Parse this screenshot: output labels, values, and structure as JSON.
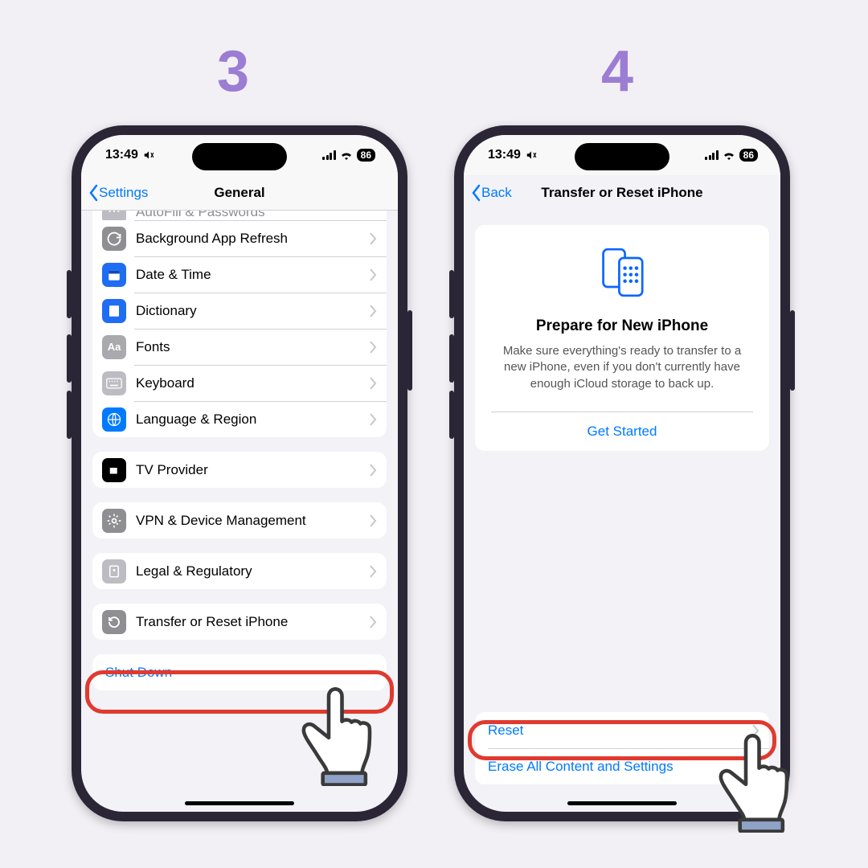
{
  "steps": {
    "three": "3",
    "four": "4"
  },
  "status": {
    "time": "13:49",
    "battery": "86"
  },
  "phone3": {
    "nav_back": "Settings",
    "nav_title": "General",
    "rows": {
      "autofill": "AutoFill & Passwords",
      "bg_refresh": "Background App Refresh",
      "date_time": "Date & Time",
      "dictionary": "Dictionary",
      "fonts": "Fonts",
      "keyboard": "Keyboard",
      "lang_region": "Language & Region",
      "tv_provider": "TV Provider",
      "vpn": "VPN & Device Management",
      "legal": "Legal & Regulatory",
      "transfer_reset": "Transfer or Reset iPhone",
      "shut_down": "Shut Down"
    }
  },
  "phone4": {
    "nav_back": "Back",
    "nav_title": "Transfer or Reset iPhone",
    "prep_title": "Prepare for New iPhone",
    "prep_desc": "Make sure everything's ready to transfer to a new iPhone, even if you don't currently have enough iCloud storage to back up.",
    "get_started": "Get Started",
    "reset": "Reset",
    "erase": "Erase All Content and Settings"
  }
}
